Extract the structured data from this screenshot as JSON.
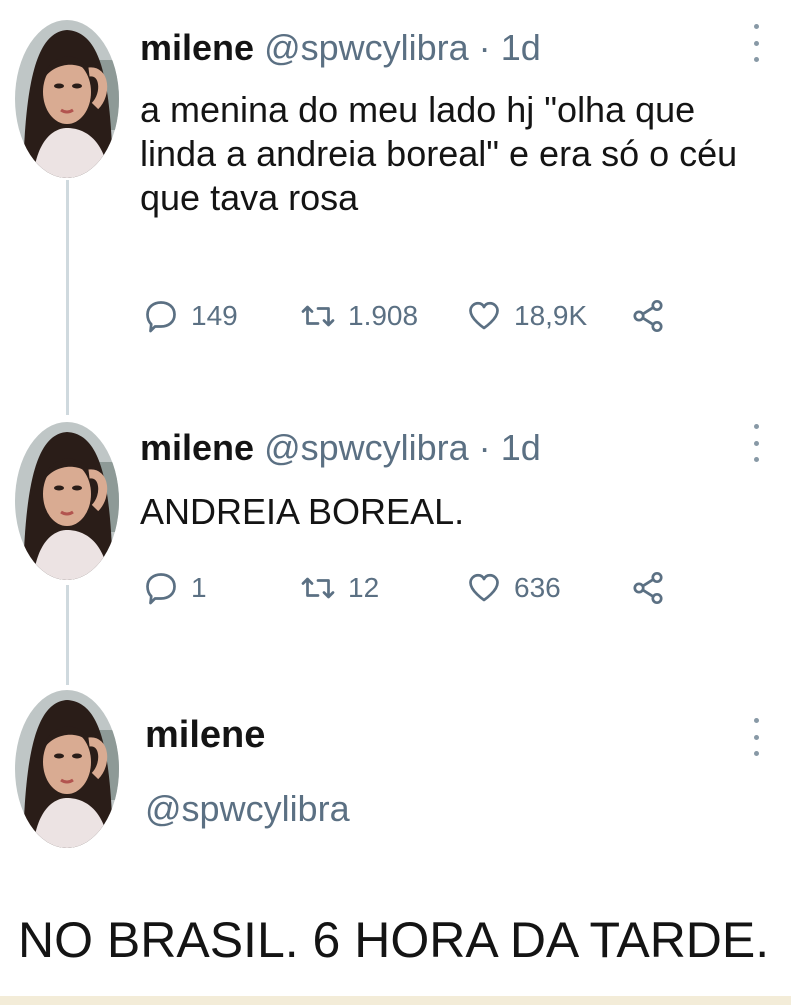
{
  "tweets": [
    {
      "name": "milene",
      "handle": "@spwcylibra",
      "separator": "·",
      "time": "1d",
      "text": "a menina do meu lado hj \"olha que linda a andreia boreal\" e era só o céu que tava rosa",
      "replies": "149",
      "retweets": "1.908",
      "likes": "18,9K"
    },
    {
      "name": "milene",
      "handle": "@spwcylibra",
      "separator": "·",
      "time": "1d",
      "text": "ANDREIA BOREAL.",
      "replies": "1",
      "retweets": "12",
      "likes": "636"
    },
    {
      "name": "milene",
      "handle": "@spwcylibra",
      "text": "NO BRASIL. 6 HORA DA TARDE."
    }
  ],
  "icons": {
    "reply": "speech-bubble-icon",
    "retweet": "retweet-arrows-icon",
    "like": "heart-icon",
    "share": "share-nodes-icon",
    "menu": "vertical-dots-icon"
  },
  "colors": {
    "text": "#141414",
    "muted": "#5b7083",
    "thread_line": "#cfd9de"
  }
}
